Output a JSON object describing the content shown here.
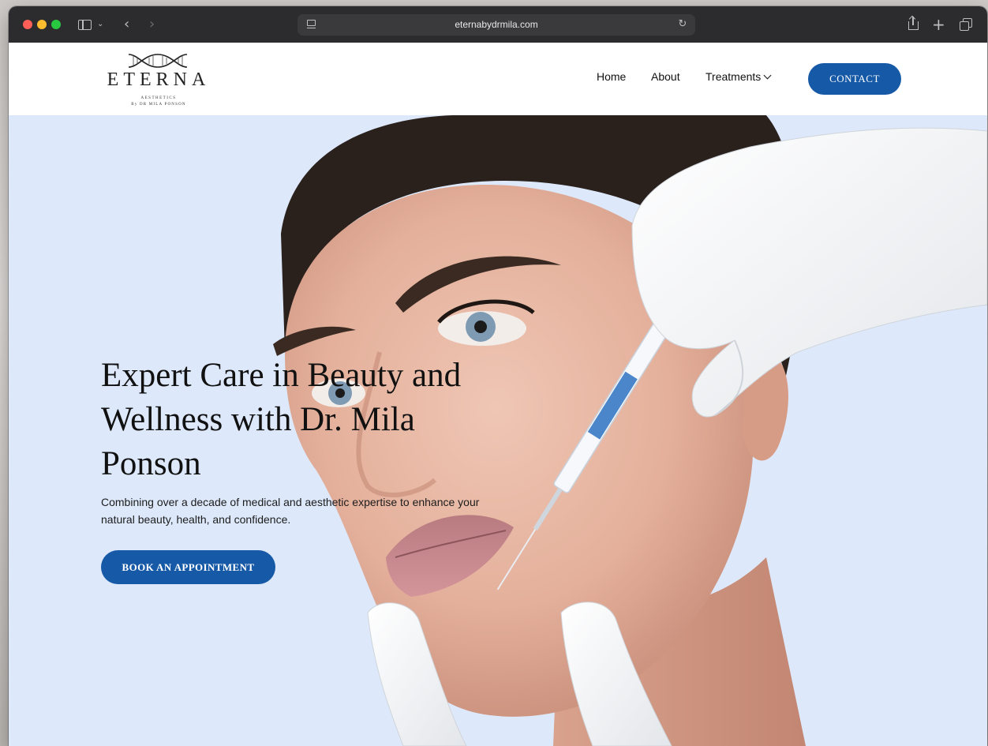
{
  "browser": {
    "url": "eternabydrmila.com",
    "icons": {
      "sidebar": "sidebar-icon",
      "sidebar_menu": "chevron-down-icon",
      "back": "chevron-left-icon",
      "forward": "chevron-right-icon",
      "reader": "reader-icon",
      "reload": "reload-icon",
      "share": "share-icon",
      "new_tab": "plus-icon",
      "tabs": "tab-overview-icon"
    }
  },
  "site": {
    "logo": {
      "wordmark": "ETERNA",
      "tagline": "AESTHETICS",
      "byline": "By DR MILA PONSON"
    },
    "nav": {
      "home": "Home",
      "about": "About",
      "treatments": "Treatments",
      "contact": "CONTACT"
    },
    "hero": {
      "title": "Expert Care in Beauty and Wellness with Dr. Mila Ponson",
      "subtitle": "Combining over a decade of medical and aesthetic expertise to enhance your natural beauty, health, and confidence.",
      "cta": "BOOK AN APPOINTMENT"
    }
  },
  "colors": {
    "brand_blue": "#1659a6",
    "hero_background": "#dde9fb",
    "toolbar": "#2c2c2e"
  }
}
